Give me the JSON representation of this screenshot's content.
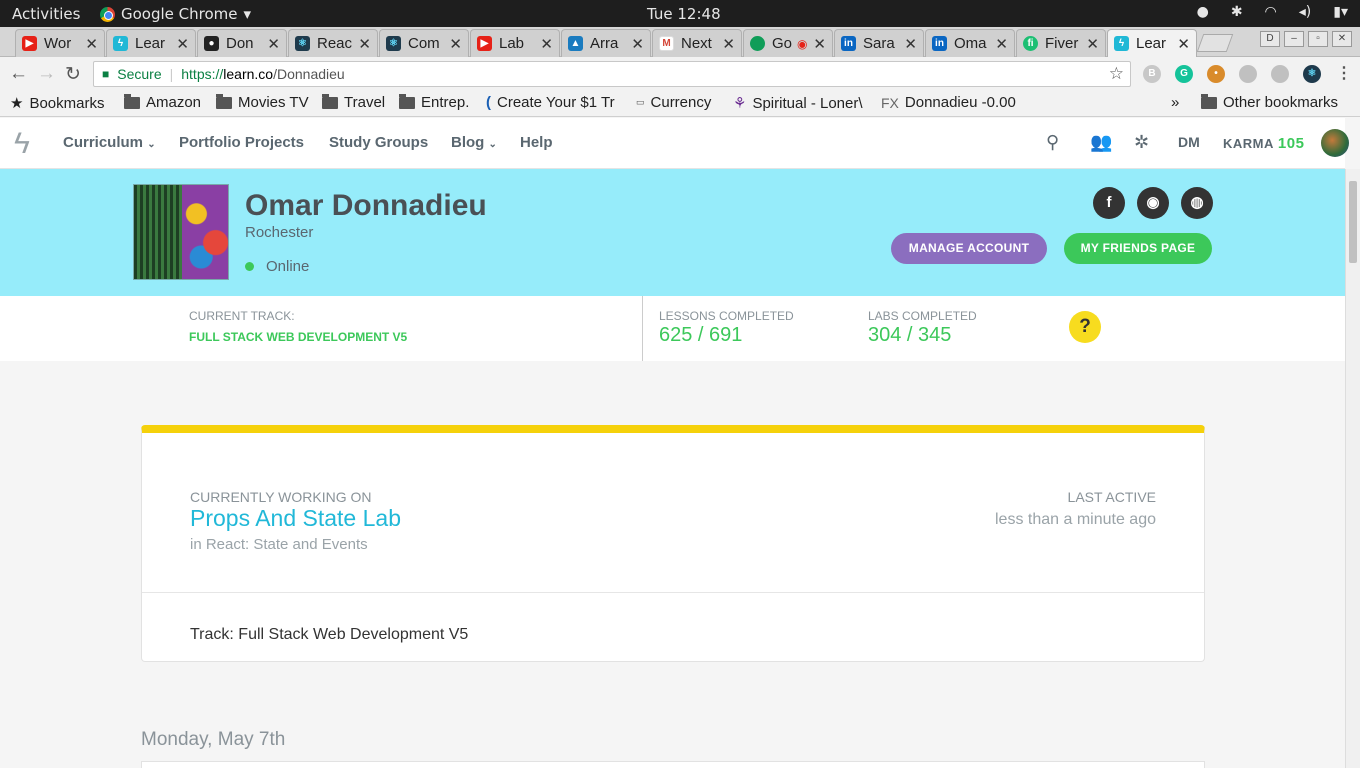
{
  "os": {
    "activities": "Activities",
    "app_name": "Google Chrome",
    "clock": "Tue 12:48"
  },
  "tabs": [
    {
      "label": "Wor",
      "color": "#e62117"
    },
    {
      "label": "Lear",
      "color": "#20b8d6"
    },
    {
      "label": "Don",
      "color": "#222222"
    },
    {
      "label": "Reac",
      "color": "#1e3a4c"
    },
    {
      "label": "Com",
      "color": "#1e3a4c"
    },
    {
      "label": "Lab",
      "color": "#e62117"
    },
    {
      "label": "Arra",
      "color": "#1a7bbf"
    },
    {
      "label": "Next",
      "color": "#d44638"
    },
    {
      "label": "Go",
      "color": "#0f9d58"
    },
    {
      "label": "Sara",
      "color": "#0a66c2"
    },
    {
      "label": "Oma",
      "color": "#0a66c2"
    },
    {
      "label": "Fiver",
      "color": "#1dbf73"
    },
    {
      "label": "Lear",
      "color": "#20b8d6"
    }
  ],
  "address": {
    "secure": "Secure",
    "scheme": "https://",
    "host": "learn.co",
    "path": "/Donnadieu"
  },
  "bookmarks": [
    "Bookmarks",
    "Amazon",
    "Movies TV",
    "Travel",
    "Entrep.",
    "Create Your $1 Tr",
    "Currency",
    "Spiritual - Loner\\",
    "Donnadieu -0.00",
    "Other bookmarks"
  ],
  "nav": {
    "curriculum": "Curriculum",
    "portfolio": "Portfolio Projects",
    "study_groups": "Study Groups",
    "blog": "Blog",
    "help": "Help",
    "dm": "DM",
    "karma_label": "KARMA",
    "karma_value": "105"
  },
  "profile": {
    "name": "Omar Donnadieu",
    "location": "Rochester",
    "status": "Online",
    "manage_account": "MANAGE ACCOUNT",
    "friends_page": "MY FRIENDS PAGE"
  },
  "stats": {
    "track_label": "CURRENT TRACK:",
    "track_value": "FULL STACK WEB DEVELOPMENT V5",
    "lessons_label": "LESSONS COMPLETED",
    "lessons_value": "625 / 691",
    "labs_label": "LABS COMPLETED",
    "labs_value": "304 / 345",
    "help": "?"
  },
  "card": {
    "working_label": "CURRENTLY WORKING ON",
    "working_title": "Props And State Lab",
    "working_sub": "in React: State and Events",
    "last_active_label": "LAST ACTIVE",
    "last_active_value": "less than a minute ago",
    "track": "Track: Full Stack Web Development V5"
  },
  "feed": {
    "date": "Monday, May 7th"
  }
}
